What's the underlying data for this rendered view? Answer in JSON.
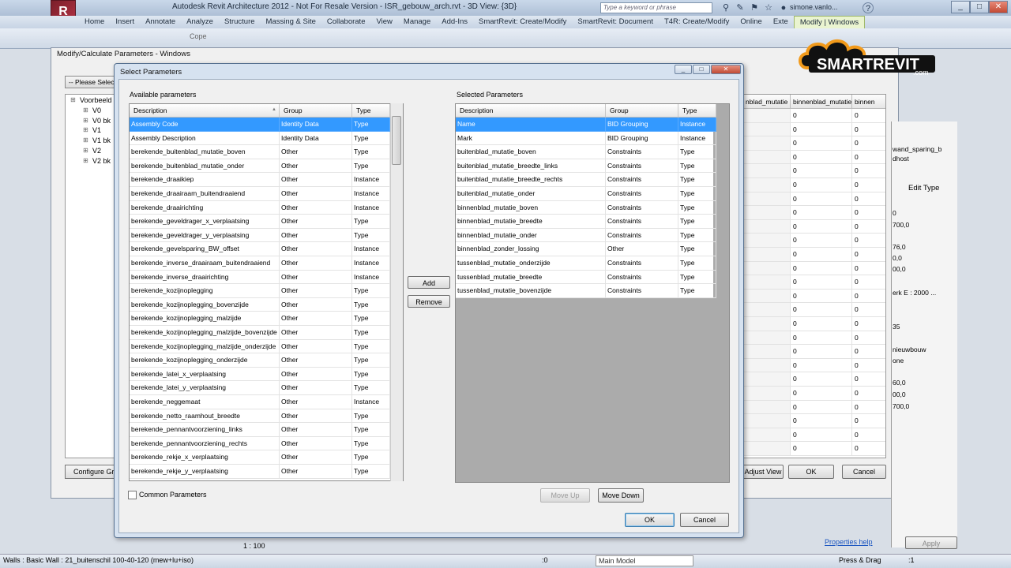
{
  "app": {
    "logo_glyph": "R",
    "title": "Autodesk Revit Architecture 2012 - Not For Resale Version -   ISR_gebouw_arch.rvt - 3D View: {3D}",
    "search_placeholder": "Type a keyword or phrase",
    "user": "simone.vanlo...",
    "help_glyph": "?",
    "min_glyph": "_",
    "max_glyph": "□",
    "close_glyph": "✕"
  },
  "ribbon": {
    "tabs": [
      "Home",
      "Insert",
      "Annotate",
      "Analyze",
      "Structure",
      "Massing & Site",
      "Collaborate",
      "View",
      "Manage",
      "Add-Ins",
      "SmartRevit: Create/Modify",
      "SmartRevit: Document",
      "T4R: Create/Modify",
      "Online",
      "Exte",
      "Modify | Windows"
    ],
    "active_tab": "Modify | Windows",
    "copy_label": "Cope"
  },
  "background_dialog": {
    "title": "Modify/Calculate Parameters - Windows",
    "please_select": "-- Please Select",
    "tree": [
      "Voorbeeld",
      "V0",
      "V0 bk",
      "V1",
      "V1 bk",
      "V2",
      "V2 bk"
    ],
    "configure_button": "Configure Grou",
    "grid_headers": [
      "nblad_mutatie",
      "binnenblad_mutatie",
      "binnen"
    ],
    "grid_value": "0",
    "adjust_button": "Adjust View",
    "ok_button": "OK",
    "cancel_button": "Cancel"
  },
  "properties": {
    "rows": [
      "wand_sparing_b",
      "dhost",
      "Edit Type",
      "0",
      "700,0",
      "76,0",
      "0,0",
      "00,0",
      "erk E : 2000 ...",
      "35",
      "nieuwbouw",
      "one",
      "60,0",
      "00,0",
      "700,0"
    ],
    "help_link": "Properties help",
    "apply_button": "Apply"
  },
  "statusbar": {
    "text": "Walls : Basic Wall : 21_buitenschil 100-40-120 (mew+lu+iso)",
    "scale": "1 : 100",
    "zero": ":0",
    "model": "Main Model",
    "press_drag": "Press & Drag",
    "filter": ":1"
  },
  "dialog": {
    "title": "Select Parameters",
    "available_label": "Available parameters",
    "selected_label": "Selected Parameters",
    "columns": [
      "Description",
      "Group",
      "Type"
    ],
    "available": [
      [
        "Assembly Code",
        "Identity Data",
        "Type"
      ],
      [
        "Assembly Description",
        "Identity Data",
        "Type"
      ],
      [
        "berekende_buitenblad_mutatie_boven",
        "Other",
        "Type"
      ],
      [
        "berekende_buitenblad_mutatie_onder",
        "Other",
        "Type"
      ],
      [
        "berekende_draaikiep",
        "Other",
        "Instance"
      ],
      [
        "berekende_draairaam_buitendraaiend",
        "Other",
        "Instance"
      ],
      [
        "berekende_draairichting",
        "Other",
        "Instance"
      ],
      [
        "berekende_geveldrager_x_verplaatsing",
        "Other",
        "Type"
      ],
      [
        "berekende_geveldrager_y_verplaatsing",
        "Other",
        "Type"
      ],
      [
        "berekende_gevelsparing_BW_offset",
        "Other",
        "Instance"
      ],
      [
        "berekende_inverse_draairaam_buitendraaiend",
        "Other",
        "Instance"
      ],
      [
        "berekende_inverse_draairichting",
        "Other",
        "Instance"
      ],
      [
        "berekende_kozijnoplegging",
        "Other",
        "Type"
      ],
      [
        "berekende_kozijnoplegging_bovenzijde",
        "Other",
        "Type"
      ],
      [
        "berekende_kozijnoplegging_malzijde",
        "Other",
        "Type"
      ],
      [
        "berekende_kozijnoplegging_malzijde_bovenzijde",
        "Other",
        "Type"
      ],
      [
        "berekende_kozijnoplegging_malzijde_onderzijde",
        "Other",
        "Type"
      ],
      [
        "berekende_kozijnoplegging_onderzijde",
        "Other",
        "Type"
      ],
      [
        "berekende_latei_x_verplaatsing",
        "Other",
        "Type"
      ],
      [
        "berekende_latei_y_verplaatsing",
        "Other",
        "Type"
      ],
      [
        "berekende_neggemaat",
        "Other",
        "Instance"
      ],
      [
        "berekende_netto_raamhout_breedte",
        "Other",
        "Type"
      ],
      [
        "berekende_pennantvoorziening_links",
        "Other",
        "Type"
      ],
      [
        "berekende_pennantvoorziening_rechts",
        "Other",
        "Type"
      ],
      [
        "berekende_rekje_x_verplaatsing",
        "Other",
        "Type"
      ],
      [
        "berekende_rekje_y_verplaatsing",
        "Other",
        "Type"
      ]
    ],
    "selected": [
      [
        "Name",
        "BID Grouping",
        "Instance"
      ],
      [
        "Mark",
        "BID Grouping",
        "Instance"
      ],
      [
        "buitenblad_mutatie_boven",
        "Constraints",
        "Type"
      ],
      [
        "buitenblad_mutatie_breedte_links",
        "Constraints",
        "Type"
      ],
      [
        "buitenblad_mutatie_breedte_rechts",
        "Constraints",
        "Type"
      ],
      [
        "buitenblad_mutatie_onder",
        "Constraints",
        "Type"
      ],
      [
        "binnenblad_mutatie_boven",
        "Constraints",
        "Type"
      ],
      [
        "binnenblad_mutatie_breedte",
        "Constraints",
        "Type"
      ],
      [
        "binnenblad_mutatie_onder",
        "Constraints",
        "Type"
      ],
      [
        "binnenblad_zonder_lossing",
        "Other",
        "Type"
      ],
      [
        "tussenblad_mutatie_onderzijde",
        "Constraints",
        "Type"
      ],
      [
        "tussenblad_mutatie_breedte",
        "Constraints",
        "Type"
      ],
      [
        "tussenblad_mutatie_bovenzijde",
        "Constraints",
        "Type"
      ]
    ],
    "add_button": "Add",
    "remove_button": "Remove",
    "move_up_button": "Move Up",
    "move_down_button": "Move Down",
    "common_parameters_label": "Common Parameters",
    "ok_button": "OK",
    "cancel_button": "Cancel"
  },
  "watermark": {
    "text": "SMARTREVIT",
    "suffix": ".com"
  },
  "colors": {
    "selection": "#3399ff",
    "active_tab": "#eaf4d0"
  }
}
